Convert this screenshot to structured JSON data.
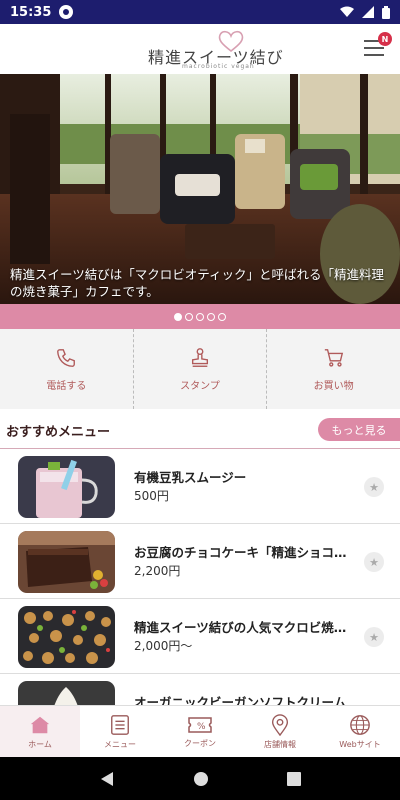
{
  "status_bar": {
    "time": "15:35"
  },
  "header": {
    "logo_main": "精進スイーツ結び",
    "logo_sub": "macrobiotic vegan",
    "notification_badge": "N"
  },
  "hero": {
    "caption": "精進スイーツ結びは「マクロビオティック」と呼ばれる「精進料理の焼き菓子」カフェです。",
    "slides": 5,
    "active_slide": 1
  },
  "actions": [
    {
      "label": "電話する",
      "icon": "phone-icon"
    },
    {
      "label": "スタンプ",
      "icon": "stamp-icon"
    },
    {
      "label": "お買い物",
      "icon": "cart-icon"
    }
  ],
  "recommended": {
    "title": "おすすめメニュー",
    "more_label": "もっと見る",
    "items": [
      {
        "name": "有機豆乳スムージー",
        "price": "500円"
      },
      {
        "name": "お豆腐のチョコケーキ「精進ショコラ」",
        "price": "2,200円"
      },
      {
        "name": "精進スイーツ結びの人気マクロビ焼き菓子",
        "price": "2,000円～"
      },
      {
        "name": "オーガニックビーガンソフトクリーム",
        "price": ""
      }
    ]
  },
  "tabs": [
    {
      "label": "ホーム",
      "icon": "home-icon",
      "active": true
    },
    {
      "label": "メニュー",
      "icon": "menu-list-icon",
      "active": false
    },
    {
      "label": "クーポン",
      "icon": "coupon-icon",
      "active": false
    },
    {
      "label": "店舗情報",
      "icon": "map-pin-icon",
      "active": false
    },
    {
      "label": "Webサイト",
      "icon": "globe-icon",
      "active": false
    }
  ],
  "colors": {
    "accent_pink": "#dd8aa6",
    "text_brown": "#9a5a5a",
    "status_bar": "#1d1d6e"
  }
}
